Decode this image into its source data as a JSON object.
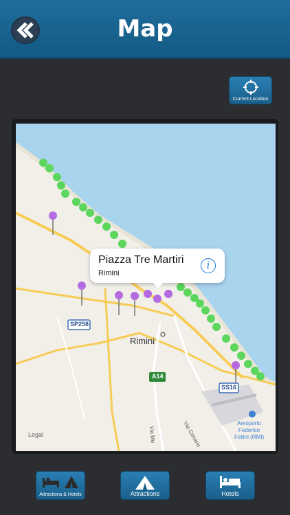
{
  "header": {
    "title": "Map",
    "back_icon": "double-chevron-left-icon"
  },
  "current_location": {
    "label": "Current Location",
    "icon": "crosshair-icon"
  },
  "map": {
    "labels": {
      "city": "Rimini",
      "road_sp258": "SP258",
      "road_a14": "A14",
      "road_ss16": "SS16",
      "via_coriano": "Via Coriano",
      "via_mo": "Via Mo",
      "airport_1": "Aeroporto",
      "airport_2": "Federico",
      "airport_3": "Fellini (RMI)",
      "legal": "Legal"
    },
    "callout": {
      "title": "Piazza Tre Martiri",
      "subtitle": "Rimini",
      "info_icon": "info-icon"
    },
    "pin_colors": {
      "green": "#5cd65c",
      "purple": "#b46ae0"
    }
  },
  "bottom_bar": [
    {
      "label": "Attractions & Hotels",
      "icon": "bed-and-tent-icon"
    },
    {
      "label": "Attractions",
      "icon": "tent-icon"
    },
    {
      "label": "Hotels",
      "icon": "bed-icon"
    }
  ]
}
